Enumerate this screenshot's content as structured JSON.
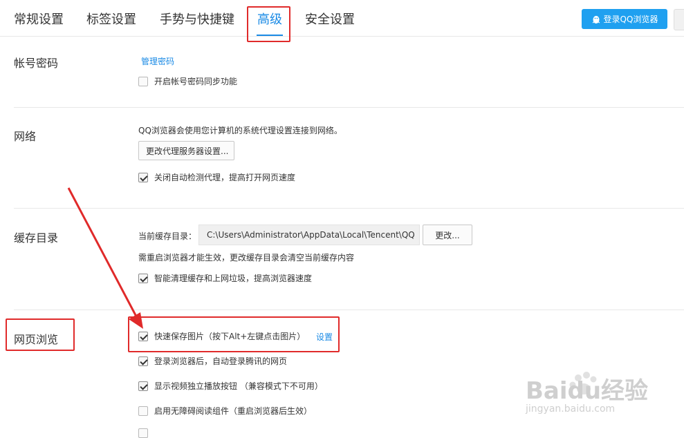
{
  "tabs": [
    {
      "label": "常规设置",
      "active": false
    },
    {
      "label": "标签设置",
      "active": false
    },
    {
      "label": "手势与快捷键",
      "active": false
    },
    {
      "label": "高级",
      "active": true
    },
    {
      "label": "安全设置",
      "active": false
    }
  ],
  "header": {
    "login_label": "登录QQ浏览器"
  },
  "sections": {
    "account": {
      "label": "帐号密码",
      "manage_link": "管理密码",
      "sync_checkbox": {
        "label": "开启帐号密码同步功能",
        "checked": false
      }
    },
    "network": {
      "label": "网络",
      "description": "QQ浏览器会使用您计算机的系统代理设置连接到网络。",
      "proxy_button": "更改代理服务器设置...",
      "auto_detect_checkbox": {
        "label": "关闭自动检测代理，提高打开网页速度",
        "checked": true
      }
    },
    "cache": {
      "label": "缓存目录",
      "current_label": "当前缓存目录：",
      "path_value": "C:\\Users\\Administrator\\AppData\\Local\\Tencent\\QQ",
      "change_button": "更改...",
      "note": "需重启浏览器才能生效，更改缓存目录会清空当前缓存内容",
      "smart_clean_checkbox": {
        "label": "智能清理缓存和上网垃圾，提高浏览器速度",
        "checked": true
      }
    },
    "browsing": {
      "label": "网页浏览",
      "quick_save": {
        "label": "快速保存图片（按下Alt+左键点击图片）",
        "checked": true,
        "settings_link": "设置"
      },
      "auto_login": {
        "label": "登录浏览器后，自动登录腾讯的网页",
        "checked": true
      },
      "video_button": {
        "label": "显示视频独立播放按钮 （兼容模式下不可用）",
        "checked": true
      },
      "accessibility": {
        "label": "启用无障碍阅读组件（重启浏览器后生效）",
        "checked": false
      }
    }
  },
  "watermark": {
    "brand": "Baidu经验",
    "url": "jingyan.baidu.com"
  },
  "colors": {
    "accent": "#1a8ae5",
    "login_button": "#1fa0f0",
    "highlight": "#e02a2a"
  }
}
